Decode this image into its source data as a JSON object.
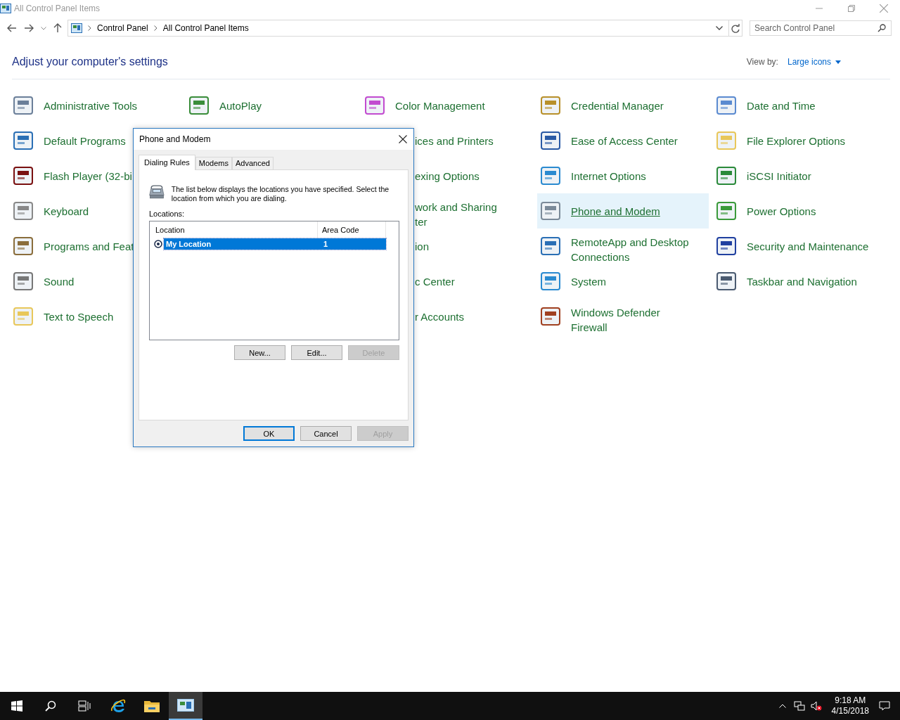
{
  "window": {
    "title": "All Control Panel Items"
  },
  "address_bar": {
    "breadcrumbs": [
      "Control Panel",
      "All Control Panel Items"
    ]
  },
  "search": {
    "placeholder": "Search Control Panel"
  },
  "heading": "Adjust your computer's settings",
  "view_by": {
    "label": "View by:",
    "value": "Large icons"
  },
  "columns": [
    [
      {
        "label": "Administrative Tools",
        "kind": "full",
        "selected": false
      },
      {
        "label": "Default Programs",
        "kind": "full",
        "selected": false
      },
      {
        "label": "Flash Player (32-bi",
        "kind": "full",
        "selected": false
      },
      {
        "label": "Keyboard",
        "kind": "full",
        "selected": false
      },
      {
        "label": "Programs and Feat",
        "kind": "full",
        "selected": false
      },
      {
        "label": "Sound",
        "kind": "full",
        "selected": false
      },
      {
        "label": "Text to Speech",
        "kind": "full",
        "selected": false
      }
    ],
    [
      {
        "label": "AutoPlay",
        "kind": "full",
        "selected": false
      }
    ],
    [
      {
        "label": "Color Management",
        "kind": "full",
        "selected": false
      },
      {
        "label": "ices and Printers",
        "kind": "cut",
        "selected": false
      },
      {
        "label": "exing Options",
        "kind": "cut",
        "selected": false
      },
      {
        "label": "work and Sharing\nter",
        "kind": "cut",
        "selected": false
      },
      {
        "label": "ion",
        "kind": "cut",
        "selected": false
      },
      {
        "label": "c Center",
        "kind": "cut",
        "selected": false
      },
      {
        "label": "r Accounts",
        "kind": "cut",
        "selected": false
      }
    ],
    [
      {
        "label": "Credential Manager",
        "kind": "full",
        "selected": false
      },
      {
        "label": "Ease of Access Center",
        "kind": "full",
        "selected": false
      },
      {
        "label": "Internet Options",
        "kind": "full",
        "selected": false
      },
      {
        "label": "Phone and Modem",
        "kind": "full",
        "selected": true
      },
      {
        "label": "RemoteApp and Desktop\nConnections",
        "kind": "full",
        "selected": false
      },
      {
        "label": "System",
        "kind": "full",
        "selected": false
      },
      {
        "label": "Windows Defender\nFirewall",
        "kind": "full",
        "selected": false
      }
    ],
    [
      {
        "label": "Date and Time",
        "kind": "full",
        "selected": false
      },
      {
        "label": "File Explorer Options",
        "kind": "full",
        "selected": false
      },
      {
        "label": "iSCSI Initiator",
        "kind": "full",
        "selected": false
      },
      {
        "label": "Power Options",
        "kind": "full",
        "selected": false
      },
      {
        "label": "Security and Maintenance",
        "kind": "full",
        "selected": false
      },
      {
        "label": "Taskbar and Navigation",
        "kind": "full",
        "selected": false
      }
    ]
  ],
  "dialog": {
    "title": "Phone and Modem",
    "tabs": [
      {
        "label": "Dialing Rules",
        "selected": true
      },
      {
        "label": "Modems",
        "selected": false
      },
      {
        "label": "Advanced",
        "selected": false
      }
    ],
    "description": "The list below displays the locations you have specified. Select the location from which you are dialing.",
    "locations": {
      "label": "Locations:",
      "columns": [
        "Location",
        "Area Code"
      ],
      "rows": [
        {
          "location": "My Location",
          "area_code": "1",
          "selected": true,
          "default": true
        }
      ]
    },
    "list_buttons": [
      {
        "label": "New...",
        "disabled": false
      },
      {
        "label": "Edit...",
        "disabled": false
      },
      {
        "label": "Delete",
        "disabled": true
      }
    ],
    "buttons": [
      {
        "label": "OK",
        "disabled": false,
        "default": true
      },
      {
        "label": "Cancel",
        "disabled": false,
        "default": false
      },
      {
        "label": "Apply",
        "disabled": true,
        "default": false
      }
    ]
  },
  "taskbar": {
    "time": "9:18 AM",
    "date": "4/15/2018"
  }
}
